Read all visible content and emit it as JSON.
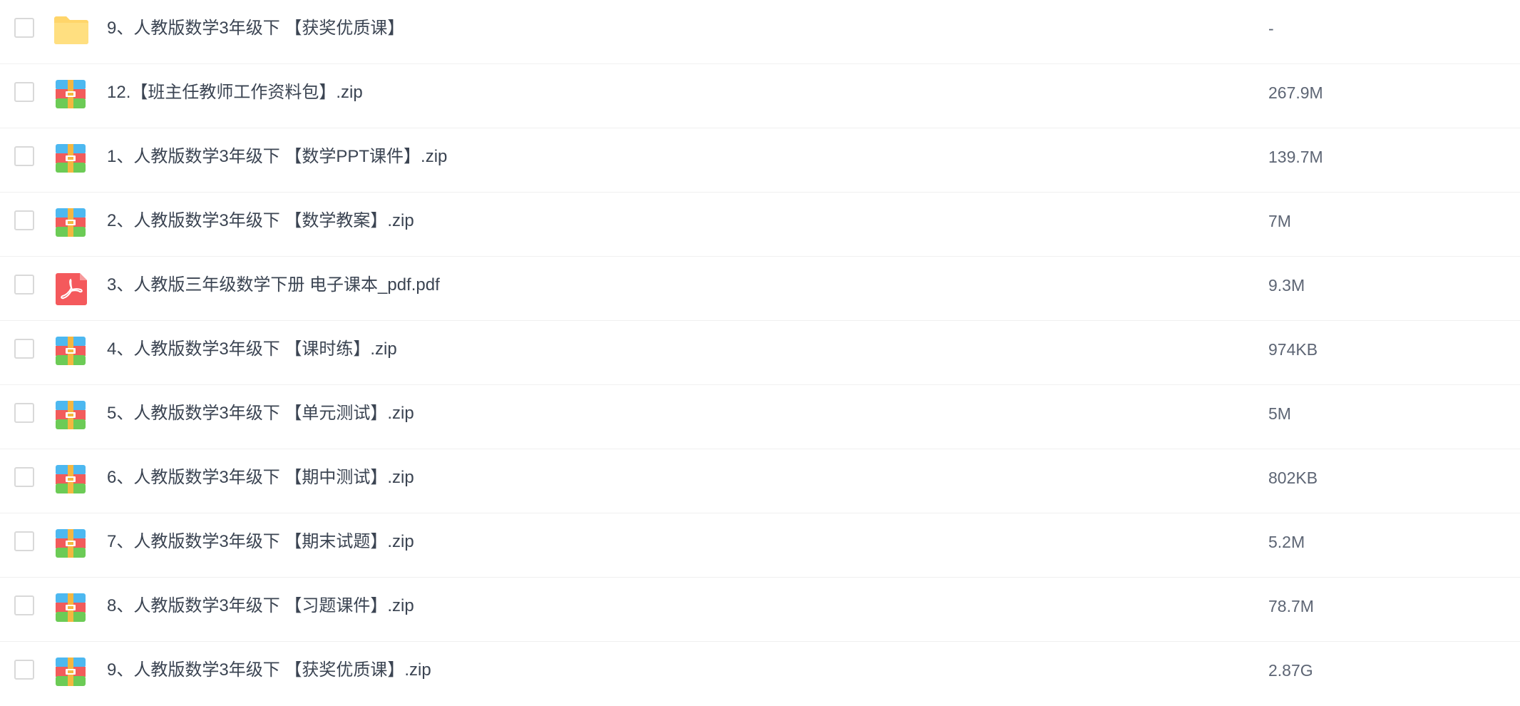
{
  "files": [
    {
      "name": "9、人教版数学3年级下 【获奖优质课】",
      "size": "-",
      "icon": "folder-icon"
    },
    {
      "name": "12.【班主任教师工作资料包】.zip",
      "size": "267.9M",
      "icon": "zip-archive-icon"
    },
    {
      "name": "1、人教版数学3年级下 【数学PPT课件】.zip",
      "size": "139.7M",
      "icon": "zip-archive-icon"
    },
    {
      "name": "2、人教版数学3年级下 【数学教案】.zip",
      "size": "7M",
      "icon": "zip-archive-icon"
    },
    {
      "name": "3、人教版三年级数学下册 电子课本_pdf.pdf",
      "size": "9.3M",
      "icon": "pdf-icon"
    },
    {
      "name": "4、人教版数学3年级下 【课时练】.zip",
      "size": "974KB",
      "icon": "zip-archive-icon"
    },
    {
      "name": "5、人教版数学3年级下 【单元测试】.zip",
      "size": "5M",
      "icon": "zip-archive-icon"
    },
    {
      "name": "6、人教版数学3年级下 【期中测试】.zip",
      "size": "802KB",
      "icon": "zip-archive-icon"
    },
    {
      "name": "7、人教版数学3年级下 【期末试题】.zip",
      "size": "5.2M",
      "icon": "zip-archive-icon"
    },
    {
      "name": "8、人教版数学3年级下 【习题课件】.zip",
      "size": "78.7M",
      "icon": "zip-archive-icon"
    },
    {
      "name": "9、人教版数学3年级下 【获奖优质课】.zip",
      "size": "2.87G",
      "icon": "zip-archive-icon"
    }
  ],
  "colors": {
    "folder": "#ffd56a",
    "pdf": "#f4595c",
    "zip_top": "#4db8f0",
    "zip_middle": "#f25b5b",
    "zip_bottom": "#6ccb56",
    "zip_band": "#f4b740",
    "text": "#3b4452",
    "size_text": "#5d6574",
    "row_border": "#f0f0f0"
  }
}
